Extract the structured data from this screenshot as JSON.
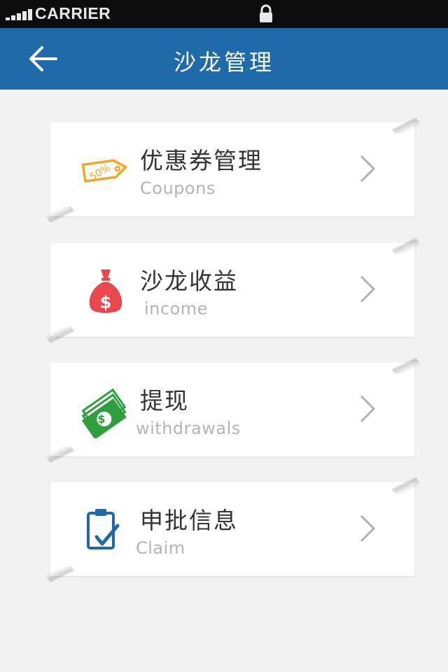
{
  "status_bar": {
    "carrier": "CARRIER"
  },
  "nav": {
    "title": "沙龙管理"
  },
  "menu": [
    {
      "title": "优惠券管理",
      "subtitle": "Coupons",
      "icon": "coupon-tag-icon",
      "icon_color": "#f5a623"
    },
    {
      "title": "沙龙收益",
      "subtitle": "income",
      "icon": "money-bag-icon",
      "icon_color": "#e8474f"
    },
    {
      "title": "提现",
      "subtitle": "withdrawals",
      "icon": "cash-stack-icon",
      "icon_color": "#2e9e3e"
    },
    {
      "title": "申批信息",
      "subtitle": "Claim",
      "icon": "clipboard-check-icon",
      "icon_color": "#1f6aa8"
    }
  ],
  "colors": {
    "nav_bg": "#1f6aa8",
    "page_bg": "#f2f2f2",
    "chevron": "#b0b0b8"
  }
}
